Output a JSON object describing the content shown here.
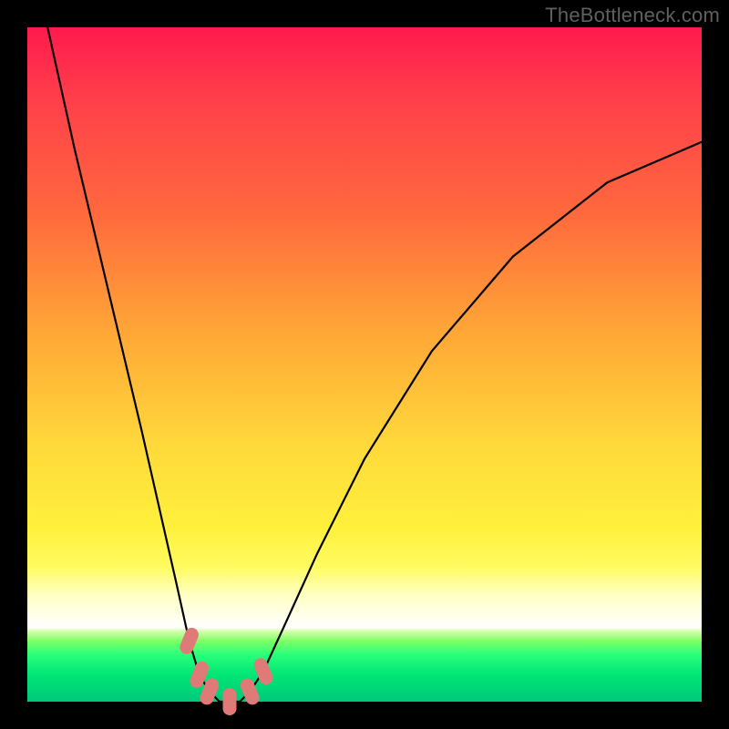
{
  "attribution": "TheBottleneck.com",
  "chart_data": {
    "type": "line",
    "title": "",
    "xlabel": "",
    "ylabel": "",
    "series": [
      {
        "name": "curve",
        "x": [
          0.03,
          0.07,
          0.12,
          0.17,
          0.22,
          0.24,
          0.255,
          0.27,
          0.285,
          0.3,
          0.315,
          0.33,
          0.35,
          0.38,
          0.43,
          0.5,
          0.6,
          0.72,
          0.86,
          1.0
        ],
        "values": [
          1.0,
          0.82,
          0.61,
          0.4,
          0.18,
          0.09,
          0.04,
          0.015,
          0.0,
          0.0,
          0.0,
          0.015,
          0.045,
          0.11,
          0.22,
          0.36,
          0.52,
          0.66,
          0.77,
          0.83
        ]
      }
    ],
    "markers": [
      {
        "x": 0.24,
        "y": 0.09
      },
      {
        "x": 0.255,
        "y": 0.04
      },
      {
        "x": 0.27,
        "y": 0.015
      },
      {
        "x": 0.3,
        "y": 0.0
      },
      {
        "x": 0.33,
        "y": 0.015
      },
      {
        "x": 0.35,
        "y": 0.045
      }
    ],
    "xlim": [
      0,
      1
    ],
    "ylim": [
      0,
      1
    ]
  },
  "colors": {
    "curve": "#000000",
    "marker": "#e07a78",
    "stage_bg": "#000000"
  }
}
